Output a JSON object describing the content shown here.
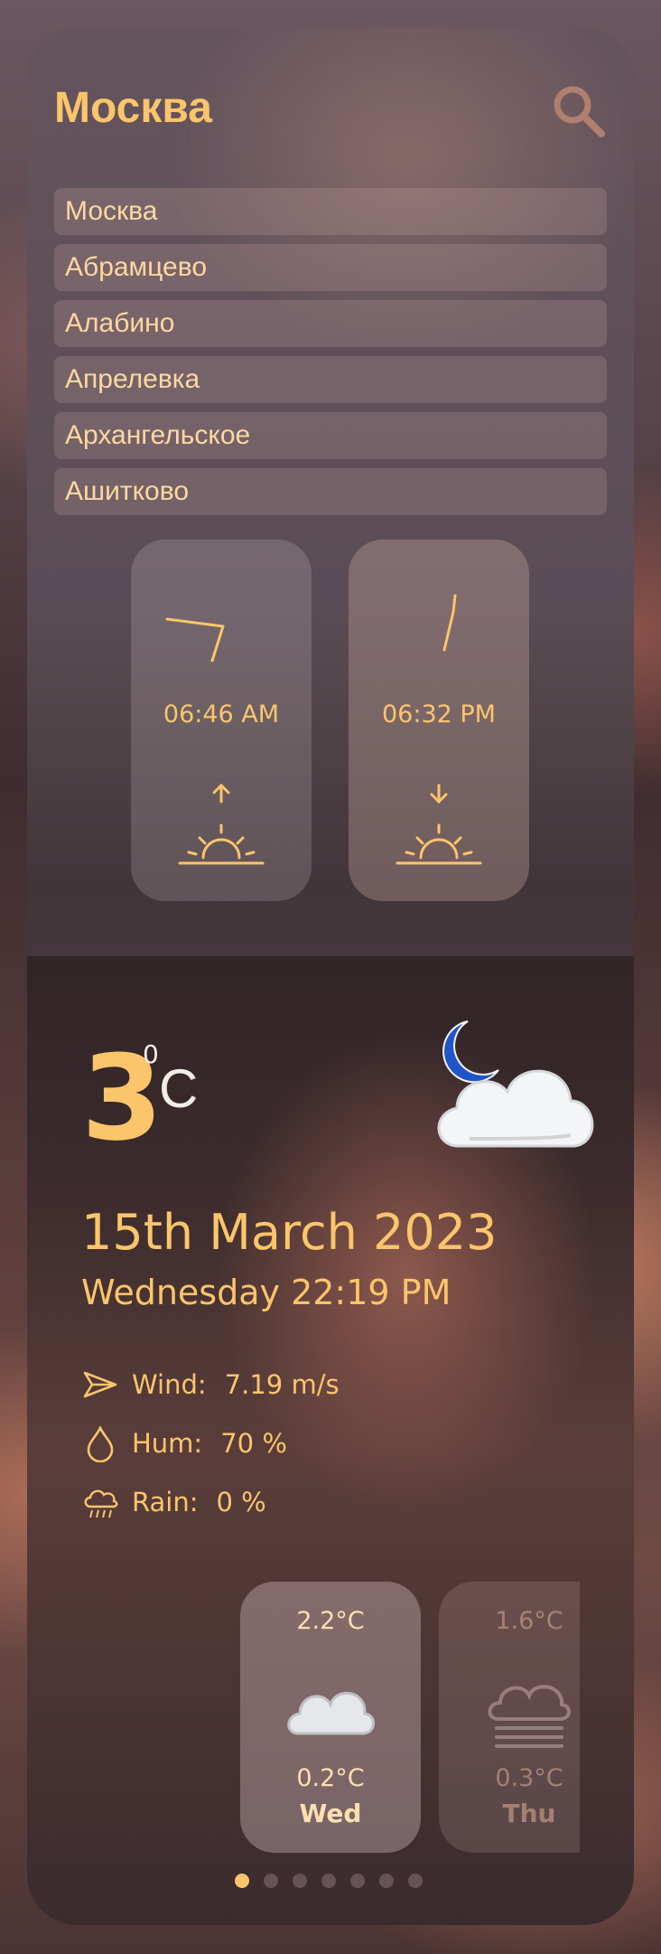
{
  "search": {
    "title": "Москва",
    "results": [
      "Москва",
      "Абрамцево",
      "Алабино",
      "Апрелевка",
      "Архангельское",
      "Ашитково"
    ]
  },
  "sun": {
    "sunrise": "06:46 AM",
    "sunset": "06:32 PM"
  },
  "current": {
    "temp": "3",
    "degree": "0",
    "unit": "C",
    "icon": "moon-cloud-icon",
    "date": "15th March 2023",
    "day_time": "Wednesday 22:19 PM",
    "wind_label": "Wind:",
    "wind_value": "7.19 m/s",
    "hum_label": "Hum:",
    "hum_value": "70 %",
    "rain_label": "Rain:",
    "rain_value": "0 %"
  },
  "forecast": [
    {
      "high": "2.2°C",
      "low": "0.2°C",
      "day": "Wed",
      "icon": "cloud-icon"
    },
    {
      "high": "1.6°C",
      "low": "0.3°C",
      "day": "Thu",
      "icon": "fog-icon"
    }
  ],
  "pagination": {
    "pages": 7,
    "active": 0
  },
  "colors": {
    "accent": "#fbc56b",
    "card": "#d7bec3"
  }
}
